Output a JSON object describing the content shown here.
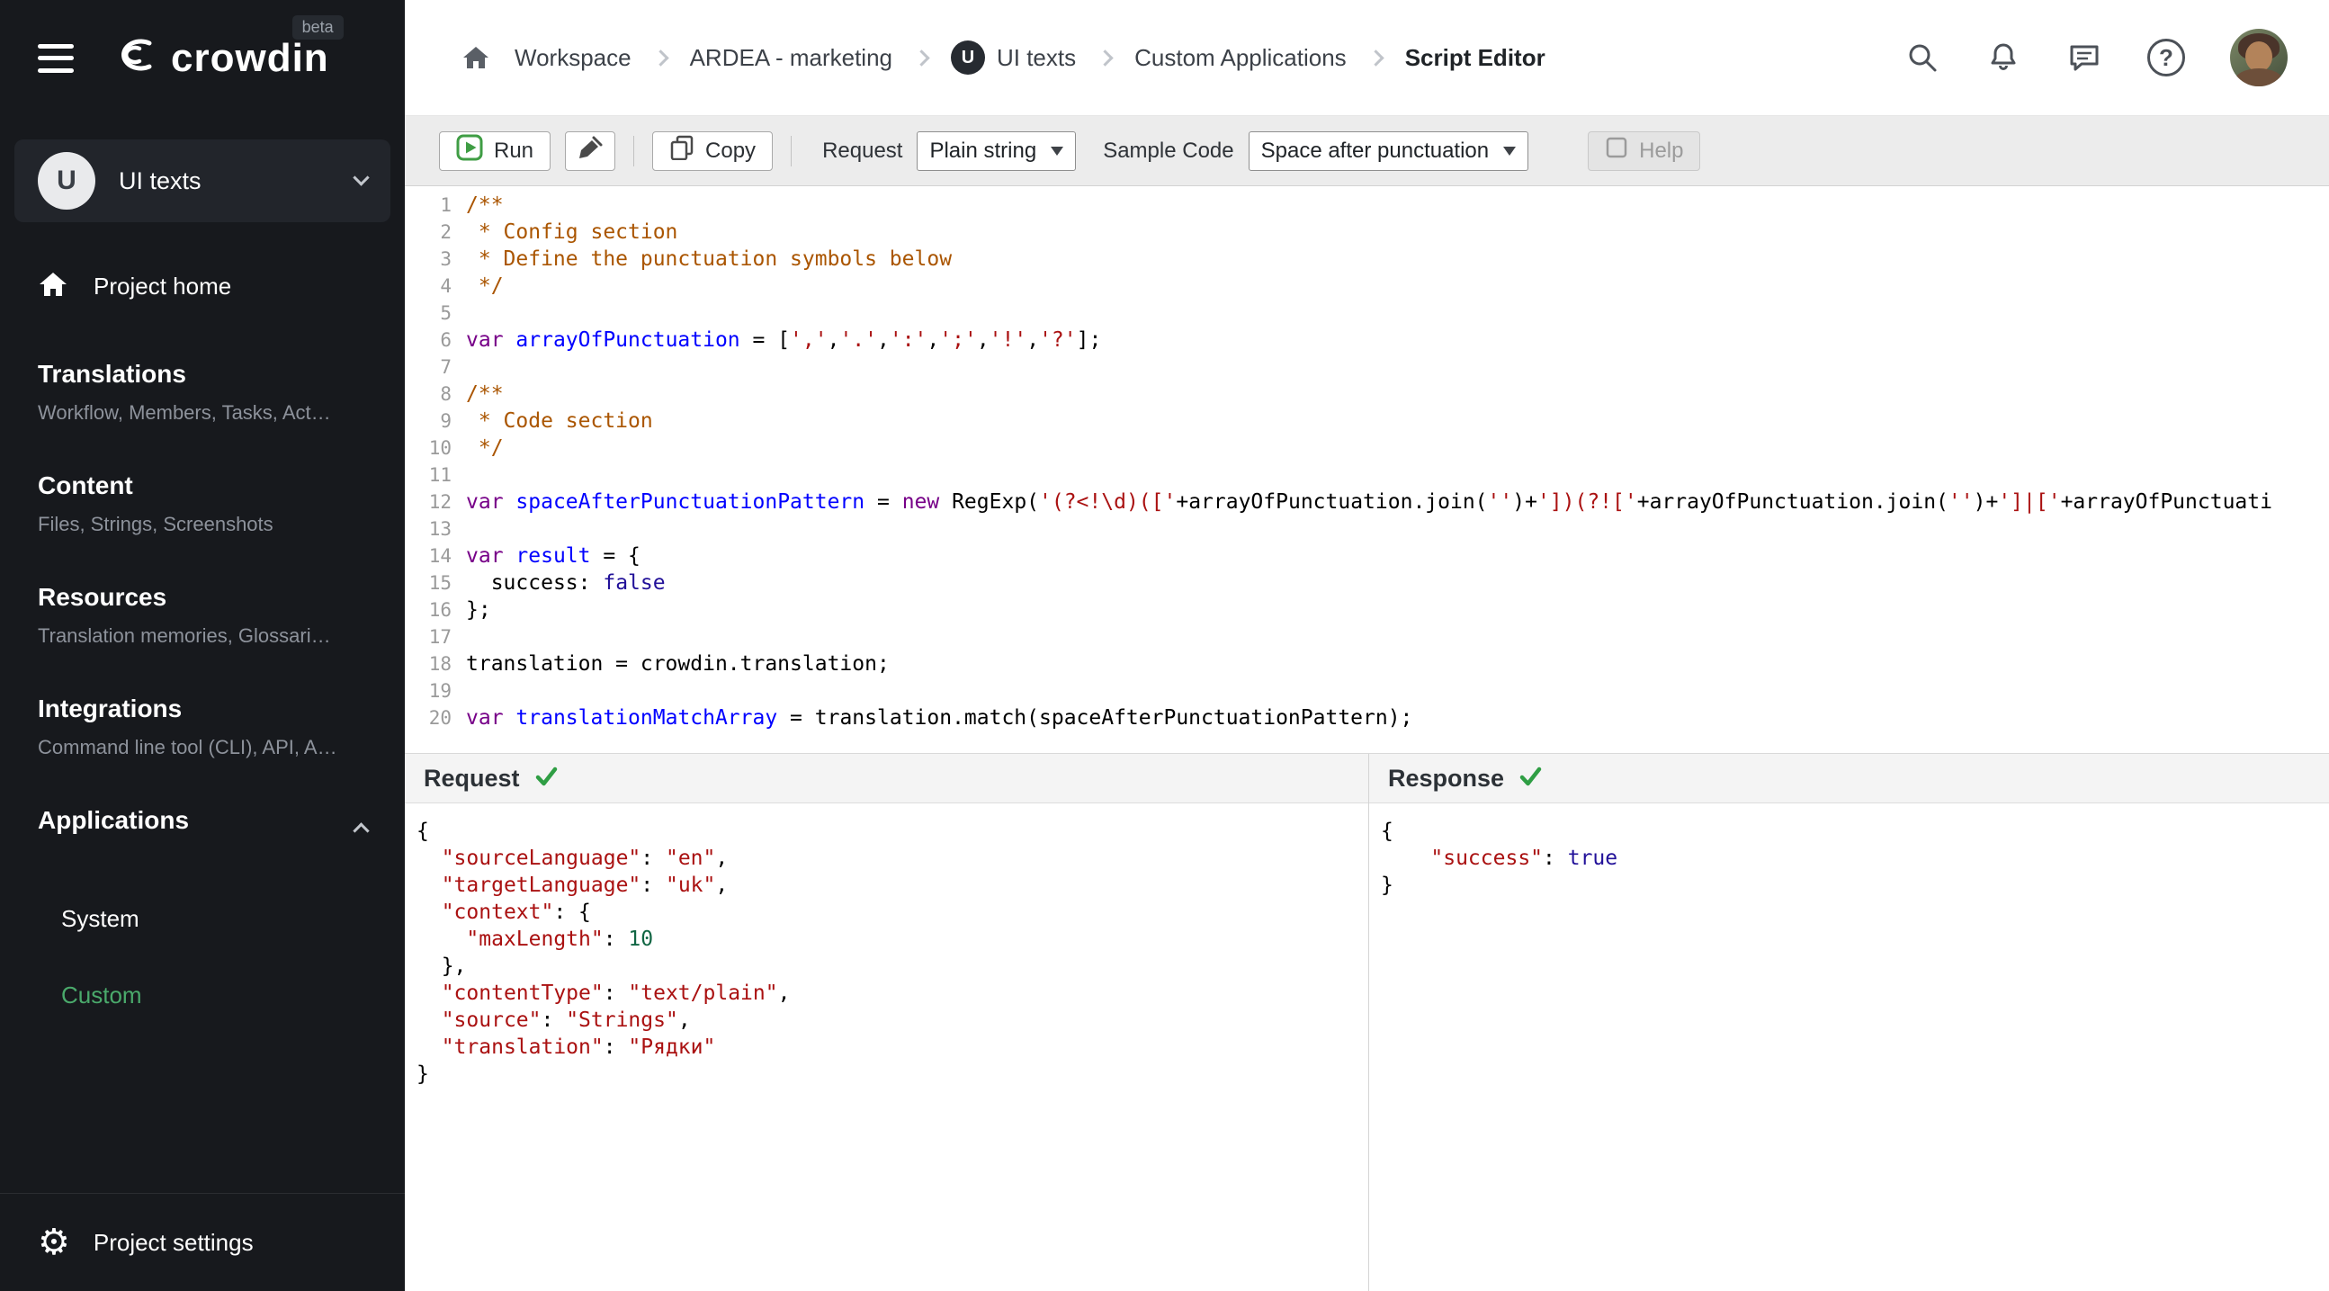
{
  "icons": {
    "gear": "⚙",
    "help_question": "?"
  },
  "header": {
    "logo_text": "crowdin",
    "beta_badge": "beta",
    "breadcrumb": {
      "items": [
        {
          "label": "Workspace"
        },
        {
          "label": "ARDEA - marketing"
        },
        {
          "label": "UI texts",
          "avatar_initial": "U"
        },
        {
          "label": "Custom Applications"
        },
        {
          "label": "Script Editor",
          "current": true
        }
      ]
    }
  },
  "sidebar": {
    "project": {
      "initial": "U",
      "name": "UI texts"
    },
    "project_home_label": "Project home",
    "sections": [
      {
        "title": "Translations",
        "subtitle": "Workflow, Members, Tasks, Act…"
      },
      {
        "title": "Content",
        "subtitle": "Files, Strings, Screenshots"
      },
      {
        "title": "Resources",
        "subtitle": "Translation memories, Glossari…"
      },
      {
        "title": "Integrations",
        "subtitle": "Command line tool (CLI), API, A…"
      },
      {
        "title": "Applications"
      }
    ],
    "applications_children": [
      {
        "label": "System",
        "active": false
      },
      {
        "label": "Custom",
        "active": true
      }
    ],
    "project_settings_label": "Project settings"
  },
  "toolbar": {
    "run_label": "Run",
    "copy_label": "Copy",
    "request_label": "Request",
    "request_value": "Plain string",
    "sample_code_label": "Sample Code",
    "sample_code_value": "Space after punctuation",
    "help_label": "Help"
  },
  "editor": {
    "lines": [
      {
        "n": 1,
        "tokens": [
          [
            "comment",
            "/**"
          ]
        ]
      },
      {
        "n": 2,
        "tokens": [
          [
            "comment",
            " * Config section"
          ]
        ]
      },
      {
        "n": 3,
        "tokens": [
          [
            "comment",
            " * Define the punctuation symbols below"
          ]
        ]
      },
      {
        "n": 4,
        "tokens": [
          [
            "comment",
            " */"
          ]
        ]
      },
      {
        "n": 5,
        "tokens": []
      },
      {
        "n": 6,
        "tokens": [
          [
            "keyword",
            "var"
          ],
          [
            "plain",
            " "
          ],
          [
            "def",
            "arrayOfPunctuation"
          ],
          [
            "plain",
            " = ["
          ],
          [
            "string",
            "','"
          ],
          [
            "plain",
            ","
          ],
          [
            "string",
            "'.'"
          ],
          [
            "plain",
            ","
          ],
          [
            "string",
            "':'"
          ],
          [
            "plain",
            ","
          ],
          [
            "string",
            "';'"
          ],
          [
            "plain",
            ","
          ],
          [
            "string",
            "'!'"
          ],
          [
            "plain",
            ","
          ],
          [
            "string",
            "'?'"
          ],
          [
            "plain",
            "];"
          ]
        ]
      },
      {
        "n": 7,
        "tokens": []
      },
      {
        "n": 8,
        "tokens": [
          [
            "comment",
            "/**"
          ]
        ]
      },
      {
        "n": 9,
        "tokens": [
          [
            "comment",
            " * Code section"
          ]
        ]
      },
      {
        "n": 10,
        "tokens": [
          [
            "comment",
            " */"
          ]
        ]
      },
      {
        "n": 11,
        "tokens": []
      },
      {
        "n": 12,
        "tokens": [
          [
            "keyword",
            "var"
          ],
          [
            "plain",
            " "
          ],
          [
            "def",
            "spaceAfterPunctuationPattern"
          ],
          [
            "plain",
            " = "
          ],
          [
            "keyword",
            "new"
          ],
          [
            "plain",
            " RegExp("
          ],
          [
            "string",
            "'(?<!\\d)(['"
          ],
          [
            "plain",
            "+arrayOfPunctuation.join("
          ],
          [
            "string",
            "''"
          ],
          [
            "plain",
            ")+"
          ],
          [
            "string",
            "'])(?!['"
          ],
          [
            "plain",
            "+arrayOfPunctuation.join("
          ],
          [
            "string",
            "''"
          ],
          [
            "plain",
            ")+"
          ],
          [
            "string",
            "']|['"
          ],
          [
            "plain",
            "+arrayOfPunctuati"
          ]
        ]
      },
      {
        "n": 13,
        "tokens": []
      },
      {
        "n": 14,
        "tokens": [
          [
            "keyword",
            "var"
          ],
          [
            "plain",
            " "
          ],
          [
            "def",
            "result"
          ],
          [
            "plain",
            " = {"
          ]
        ]
      },
      {
        "n": 15,
        "tokens": [
          [
            "plain",
            "  "
          ],
          [
            "property",
            "success"
          ],
          [
            "plain",
            ": "
          ],
          [
            "atom",
            "false"
          ]
        ]
      },
      {
        "n": 16,
        "tokens": [
          [
            "plain",
            "};"
          ]
        ]
      },
      {
        "n": 17,
        "tokens": []
      },
      {
        "n": 18,
        "tokens": [
          [
            "plain",
            "translation = crowdin.translation;"
          ]
        ]
      },
      {
        "n": 19,
        "tokens": []
      },
      {
        "n": 20,
        "tokens": [
          [
            "keyword",
            "var"
          ],
          [
            "plain",
            " "
          ],
          [
            "def",
            "translationMatchArray"
          ],
          [
            "plain",
            " = translation.match(spaceAfterPunctuationPattern);"
          ]
        ]
      }
    ]
  },
  "request_panel": {
    "title": "Request",
    "status": "success",
    "lines": [
      [
        [
          "plain",
          "{"
        ]
      ],
      [
        [
          "plain",
          "  "
        ],
        [
          "key",
          "\"sourceLanguage\""
        ],
        [
          "plain",
          ": "
        ],
        [
          "string",
          "\"en\""
        ],
        [
          "plain",
          ","
        ]
      ],
      [
        [
          "plain",
          "  "
        ],
        [
          "key",
          "\"targetLanguage\""
        ],
        [
          "plain",
          ": "
        ],
        [
          "string",
          "\"uk\""
        ],
        [
          "plain",
          ","
        ]
      ],
      [
        [
          "plain",
          "  "
        ],
        [
          "key",
          "\"context\""
        ],
        [
          "plain",
          ": {"
        ]
      ],
      [
        [
          "plain",
          "    "
        ],
        [
          "key",
          "\"maxLength\""
        ],
        [
          "plain",
          ": "
        ],
        [
          "number",
          "10"
        ]
      ],
      [
        [
          "plain",
          "  },"
        ]
      ],
      [
        [
          "plain",
          "  "
        ],
        [
          "key",
          "\"contentType\""
        ],
        [
          "plain",
          ": "
        ],
        [
          "string",
          "\"text/plain\""
        ],
        [
          "plain",
          ","
        ]
      ],
      [
        [
          "plain",
          "  "
        ],
        [
          "key",
          "\"source\""
        ],
        [
          "plain",
          ": "
        ],
        [
          "string",
          "\"Strings\""
        ],
        [
          "plain",
          ","
        ]
      ],
      [
        [
          "plain",
          "  "
        ],
        [
          "key",
          "\"translation\""
        ],
        [
          "plain",
          ": "
        ],
        [
          "string",
          "\"Рядки\""
        ]
      ],
      [
        [
          "plain",
          "}"
        ]
      ]
    ]
  },
  "response_panel": {
    "title": "Response",
    "status": "success",
    "lines": [
      [
        [
          "plain",
          "{"
        ]
      ],
      [
        [
          "plain",
          "    "
        ],
        [
          "key",
          "\"success\""
        ],
        [
          "plain",
          ": "
        ],
        [
          "atom",
          "true"
        ]
      ],
      [
        [
          "plain",
          "}"
        ]
      ]
    ]
  }
}
